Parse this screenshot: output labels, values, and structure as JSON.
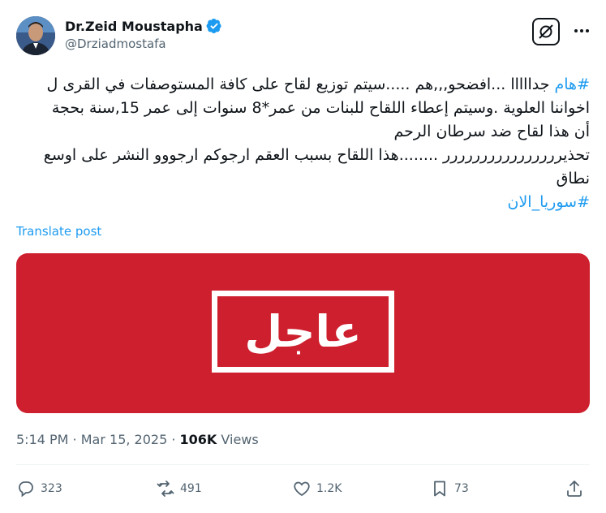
{
  "author": {
    "display_name": "Dr.Zeid Moustapha",
    "handle": "@Drziadmostafa",
    "verified": true
  },
  "post": {
    "lines": [
      {
        "hashtag": "#هام",
        "text": " جدااااا ...افضحو,,,هم .....سيتم توزيع لقاح على كافة المستوصفات في القرى ل"
      },
      {
        "hashtag": "",
        "text": "اخواننا العلوية .وسيتم إعطاء اللقاح للبنات من عمر*8 سنوات إلى عمر 15,سنة بحجة"
      },
      {
        "hashtag": "",
        "text": "أن هذا لقاح ضد سرطان الرحم"
      },
      {
        "hashtag": "",
        "text": "تحذيرررررررررررررررر ........هذا اللقاح بسبب العقم ارجوكم ارجووو النشر على اوسع"
      },
      {
        "hashtag": "",
        "text": "نطاق"
      },
      {
        "hashtag": "#سوريا_الان",
        "text": ""
      }
    ],
    "translate_label": "Translate post",
    "media_text": "عاجل",
    "media_color": "#ce1f2e"
  },
  "meta": {
    "time": "5:14 PM",
    "separator": " · ",
    "date": "Mar 15, 2025",
    "views_count": "106K",
    "views_label": " Views"
  },
  "actions": {
    "replies": "323",
    "reposts": "491",
    "likes": "1.2K",
    "bookmarks": "73"
  },
  "colors": {
    "link": "#1d9bf0",
    "text": "#0f1419",
    "secondary": "#536471",
    "verified": "#1d9bf0"
  }
}
